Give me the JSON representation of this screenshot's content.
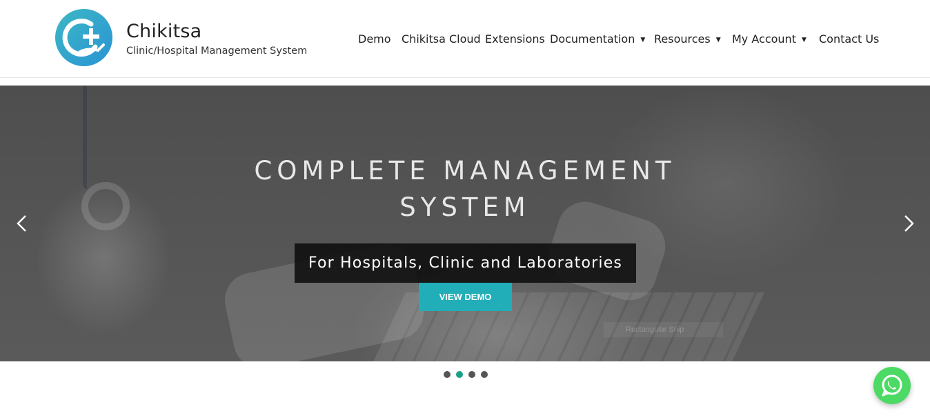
{
  "brand": {
    "name": "Chikitsa",
    "tagline": "Clinic/Hospital Management System",
    "logo_icon": "clinic-plus-hand-logo"
  },
  "nav": {
    "items": [
      {
        "label": "Demo",
        "dropdown": false
      },
      {
        "label": "Chikitsa Cloud",
        "dropdown": false
      },
      {
        "label": "Extensions",
        "dropdown": false
      },
      {
        "label": "Documentation",
        "dropdown": true
      },
      {
        "label": "Resources",
        "dropdown": true
      },
      {
        "label": "My Account",
        "dropdown": true
      },
      {
        "label": "Contact Us",
        "dropdown": false
      }
    ],
    "caret": "▼"
  },
  "hero": {
    "title_line1": "COMPLETE MANAGEMENT",
    "title_line2": "SYSTEM",
    "subtitle": "For Hospitals, Clinic and Laboratories",
    "button_label": "VIEW DEMO",
    "background_text": "Rectangular Snip",
    "prev_icon": "chevron-left-icon",
    "next_icon": "chevron-right-icon"
  },
  "carousel": {
    "slide_count": 4,
    "active_index": 1
  },
  "colors": {
    "accent": "#22aeb8",
    "active_dot": "#1aa089",
    "whatsapp": "#4cd964"
  },
  "chat": {
    "icon": "whatsapp-icon"
  }
}
